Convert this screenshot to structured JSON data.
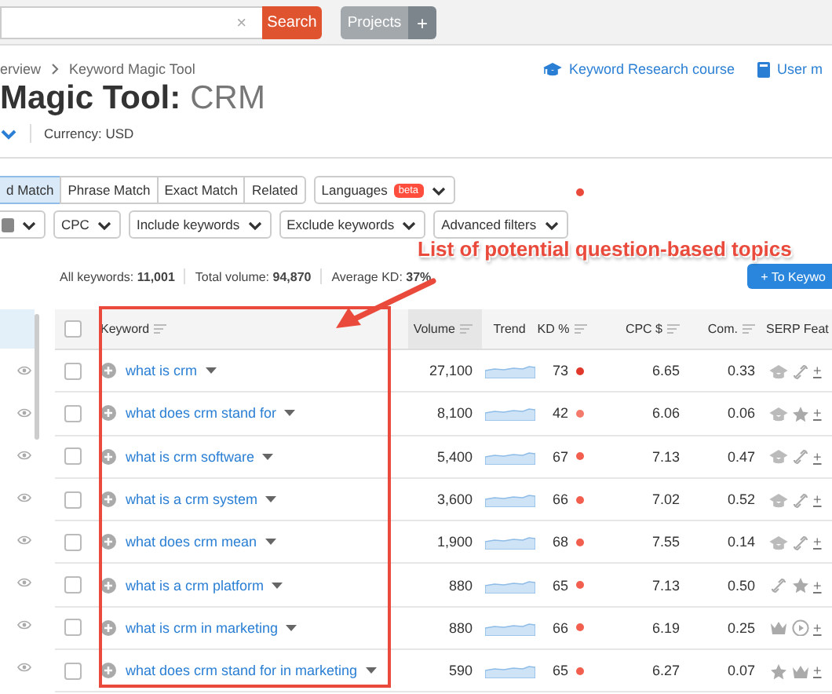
{
  "top_bar": {
    "search_clear": "×",
    "search_button": "Search",
    "projects_button": "Projects",
    "add_button": "+"
  },
  "breadcrumb": [
    "erview",
    "Keyword Magic Tool"
  ],
  "links": [
    {
      "kind": "course",
      "label": "Keyword Research course"
    },
    {
      "kind": "manual",
      "label": "User m"
    }
  ],
  "title": {
    "main": "Magic Tool:",
    "keyword": "CRM"
  },
  "currency": "Currency: USD",
  "match_tabs": [
    {
      "label": "d Match",
      "selected": true
    },
    {
      "label": "Phrase Match",
      "selected": false
    },
    {
      "label": "Exact Match",
      "selected": false
    },
    {
      "label": "Related",
      "selected": false
    }
  ],
  "languages": {
    "label": "Languages",
    "badge": "beta"
  },
  "filters": [
    {
      "kind": "badge"
    },
    {
      "kind": "dropdown",
      "label": "CPC"
    },
    {
      "kind": "dropdown",
      "label": "Include keywords"
    },
    {
      "kind": "dropdown",
      "label": "Exclude keywords"
    },
    {
      "kind": "dropdown",
      "label": "Advanced filters"
    }
  ],
  "stats": [
    {
      "label": "All keywords:",
      "value": "11,001"
    },
    {
      "label": "Total volume:",
      "value": "94,870"
    },
    {
      "label": "Average KD:",
      "value": "37%"
    }
  ],
  "export_button": {
    "icon": "+",
    "label": "To Keywo"
  },
  "sidebar": {
    "items": [
      {
        "selected": true
      },
      {
        "selected": false
      },
      {
        "selected": false
      },
      {
        "selected": false
      },
      {
        "selected": false
      },
      {
        "selected": false
      },
      {
        "selected": false
      },
      {
        "selected": false
      },
      {
        "selected": false
      }
    ]
  },
  "table": {
    "select_all": false,
    "columns": [
      "Keyword",
      "Volume",
      "Trend",
      "KD %",
      "CPC $",
      "Com.",
      "SERP Feat"
    ],
    "rows": [
      {
        "checked": false,
        "keyword": "what is crm",
        "volume": "27,100",
        "kd": "73",
        "color": "#e0392b",
        "cpc": "6.65",
        "com": "0.33",
        "serp": [
          {
            "kind": "cap"
          },
          {
            "kind": "link"
          }
        ],
        "more": "+"
      },
      {
        "checked": false,
        "keyword": "what does crm stand for",
        "volume": "8,100",
        "kd": "42",
        "color": "#f47a6c",
        "cpc": "6.06",
        "com": "0.06",
        "serp": [
          {
            "kind": "cap"
          },
          {
            "kind": "star"
          }
        ],
        "more": "+"
      },
      {
        "checked": false,
        "keyword": "what is crm software",
        "volume": "5,400",
        "kd": "67",
        "color": "#f25f4f",
        "cpc": "7.13",
        "com": "0.47",
        "serp": [
          {
            "kind": "cap"
          },
          {
            "kind": "link"
          }
        ],
        "more": "+"
      },
      {
        "checked": false,
        "keyword": "what is a crm system",
        "volume": "3,600",
        "kd": "66",
        "color": "#f25f4f",
        "cpc": "7.02",
        "com": "0.52",
        "serp": [
          {
            "kind": "cap"
          },
          {
            "kind": "link"
          }
        ],
        "more": "+"
      },
      {
        "checked": false,
        "keyword": "what does crm mean",
        "volume": "1,900",
        "kd": "68",
        "color": "#f25f4f",
        "cpc": "7.55",
        "com": "0.14",
        "serp": [
          {
            "kind": "cap"
          },
          {
            "kind": "link"
          }
        ],
        "more": "+"
      },
      {
        "checked": false,
        "keyword": "what is a crm platform",
        "volume": "880",
        "kd": "65",
        "color": "#f25f4f",
        "cpc": "7.13",
        "com": "0.50",
        "serp": [
          {
            "kind": "link"
          },
          {
            "kind": "star"
          }
        ],
        "more": "+"
      },
      {
        "checked": false,
        "keyword": "what is crm in marketing",
        "volume": "880",
        "kd": "66",
        "color": "#f25f4f",
        "cpc": "6.19",
        "com": "0.25",
        "serp": [
          {
            "kind": "crown"
          },
          {
            "kind": "play"
          }
        ],
        "more": "+"
      },
      {
        "checked": false,
        "keyword": "what does crm stand for in marketing",
        "volume": "590",
        "kd": "65",
        "color": "#f25f4f",
        "cpc": "6.27",
        "com": "0.07",
        "serp": [
          {
            "kind": "star"
          },
          {
            "kind": "crown"
          }
        ],
        "more": "+"
      }
    ]
  },
  "annotation": {
    "text": "List of potential question-based topics"
  }
}
